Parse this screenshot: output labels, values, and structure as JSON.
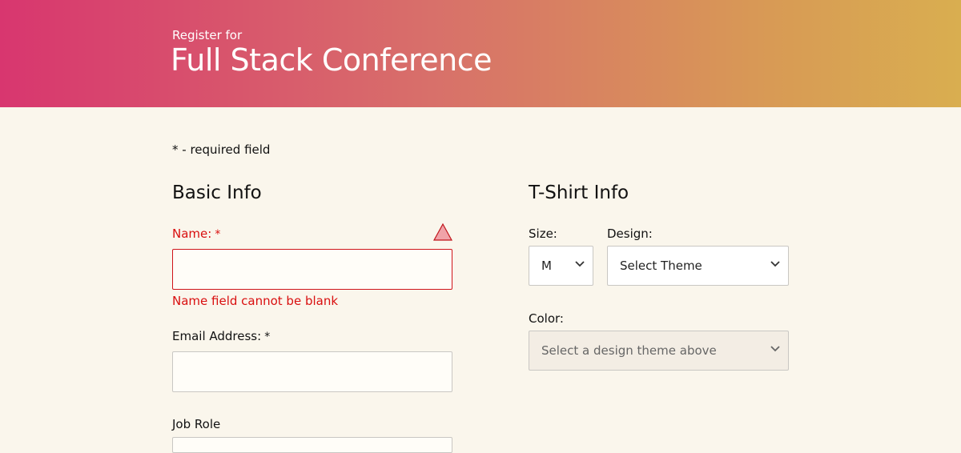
{
  "header": {
    "subtitle": "Register for",
    "title": "Full Stack Conference"
  },
  "required_note": "* - required field",
  "basic_info": {
    "heading": "Basic Info",
    "name_label": "Name:",
    "name_asterisk": "*",
    "name_value": "",
    "name_error": "Name field cannot be blank",
    "email_label": "Email Address:",
    "email_asterisk": "*",
    "email_value": "",
    "job_role_label": "Job Role"
  },
  "tshirt_info": {
    "heading": "T-Shirt Info",
    "size_label": "Size:",
    "size_value": "M",
    "design_label": "Design:",
    "design_value": "Select Theme",
    "color_label": "Color:",
    "color_value": "Select a design theme above"
  },
  "colors": {
    "error": "#d90f0f",
    "background": "#faf6ec",
    "header_gradient_start": "#d8366f",
    "header_gradient_end": "#d9ae50"
  }
}
